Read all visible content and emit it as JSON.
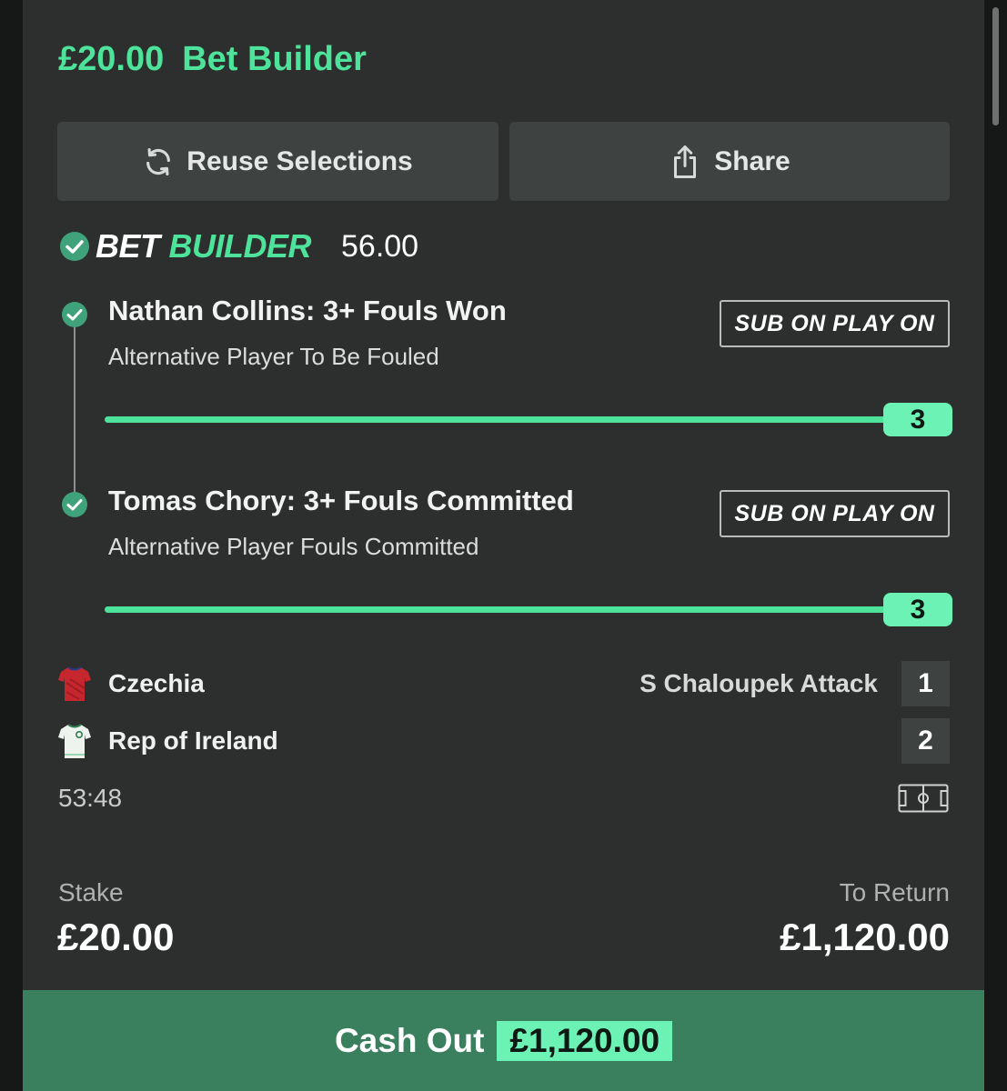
{
  "bet": {
    "stake_display": "£20.00",
    "type": "Bet Builder"
  },
  "actions": {
    "reuse_label": "Reuse Selections",
    "share_label": "Share"
  },
  "bet_builder": {
    "logo_word1": "BET",
    "logo_word2": "BUILDER",
    "odds": "56.00"
  },
  "legs": [
    {
      "title": "Nathan Collins: 3+ Fouls Won",
      "market": "Alternative Player To Be Fouled",
      "badge": "SUB ON PLAY ON",
      "progress_value": "3",
      "progress_fraction": 1.0
    },
    {
      "title": "Tomas Chory: 3+ Fouls Committed",
      "market": "Alternative Player Fouls Committed",
      "badge": "SUB ON PLAY ON",
      "progress_value": "3",
      "progress_fraction": 1.0
    }
  ],
  "match": {
    "home": {
      "name": "Czechia",
      "score": "1",
      "kit_icon": "red-shirt-icon"
    },
    "away": {
      "name": "Rep of Ireland",
      "score": "2",
      "kit_icon": "white-shirt-icon"
    },
    "last_event": "S Chaloupek Attack",
    "clock": "53:48"
  },
  "summary": {
    "stake_label": "Stake",
    "stake_value": "£20.00",
    "return_label": "To Return",
    "return_value": "£1,120.00"
  },
  "cashout": {
    "label": "Cash Out",
    "amount": "£1,120.00"
  },
  "colors": {
    "accent": "#4ee39a",
    "badge": "#6cf2b4",
    "card": "#2c2f2e",
    "cashout_bg": "#3a7f5e"
  }
}
